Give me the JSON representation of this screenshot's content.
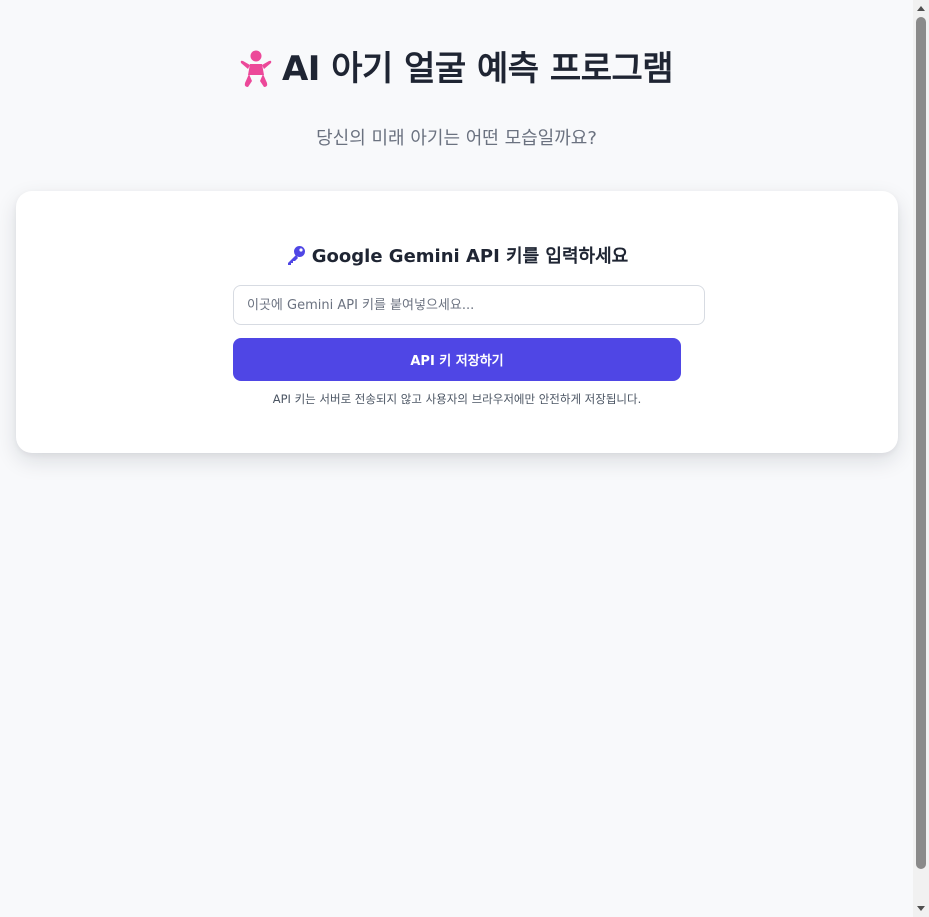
{
  "header": {
    "icon": "baby-icon",
    "title": "AI 아기 얼굴 예측 프로그램",
    "subtitle": "당신의 미래 아기는 어떤 모습일까요?"
  },
  "api_card": {
    "icon": "key-icon",
    "title": "Google Gemini API 키를 입력하세요",
    "input_value": "",
    "input_placeholder": "이곳에 Gemini API 키를 붙여넣으세요...",
    "save_label": "API 키 저장하기",
    "note": "API 키는 서버로 전송되지 않고 사용자의 브라우저에만 안전하게 저장됩니다."
  },
  "colors": {
    "background": "#f8f9fb",
    "accent": "#4f46e5",
    "baby_icon": "#ec4899",
    "key_icon": "#4f46e5",
    "title_text": "#1f2533",
    "muted_text": "#6b7280"
  }
}
